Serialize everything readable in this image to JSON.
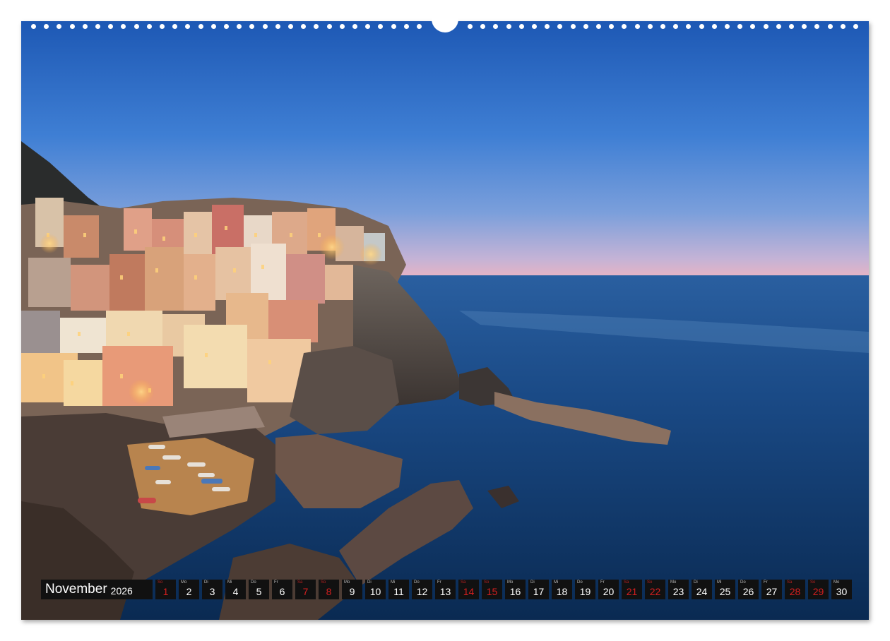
{
  "calendar": {
    "month": "November",
    "year": "2026",
    "days": [
      {
        "n": "1",
        "wd": "So",
        "weekend": true
      },
      {
        "n": "2",
        "wd": "Mo",
        "weekend": false
      },
      {
        "n": "3",
        "wd": "Di",
        "weekend": false
      },
      {
        "n": "4",
        "wd": "Mi",
        "weekend": false
      },
      {
        "n": "5",
        "wd": "Do",
        "weekend": false
      },
      {
        "n": "6",
        "wd": "Fr",
        "weekend": false
      },
      {
        "n": "7",
        "wd": "Sa",
        "weekend": true
      },
      {
        "n": "8",
        "wd": "So",
        "weekend": true
      },
      {
        "n": "9",
        "wd": "Mo",
        "weekend": false
      },
      {
        "n": "10",
        "wd": "Di",
        "weekend": false
      },
      {
        "n": "11",
        "wd": "Mi",
        "weekend": false
      },
      {
        "n": "12",
        "wd": "Do",
        "weekend": false
      },
      {
        "n": "13",
        "wd": "Fr",
        "weekend": false
      },
      {
        "n": "14",
        "wd": "Sa",
        "weekend": true
      },
      {
        "n": "15",
        "wd": "So",
        "weekend": true
      },
      {
        "n": "16",
        "wd": "Mo",
        "weekend": false
      },
      {
        "n": "17",
        "wd": "Di",
        "weekend": false
      },
      {
        "n": "18",
        "wd": "Mi",
        "weekend": false
      },
      {
        "n": "19",
        "wd": "Do",
        "weekend": false
      },
      {
        "n": "20",
        "wd": "Fr",
        "weekend": false
      },
      {
        "n": "21",
        "wd": "Sa",
        "weekend": true
      },
      {
        "n": "22",
        "wd": "So",
        "weekend": true
      },
      {
        "n": "23",
        "wd": "Mo",
        "weekend": false
      },
      {
        "n": "24",
        "wd": "Di",
        "weekend": false
      },
      {
        "n": "25",
        "wd": "Mi",
        "weekend": false
      },
      {
        "n": "26",
        "wd": "Do",
        "weekend": false
      },
      {
        "n": "27",
        "wd": "Fr",
        "weekend": false
      },
      {
        "n": "28",
        "wd": "Sa",
        "weekend": true
      },
      {
        "n": "29",
        "wd": "So",
        "weekend": true
      },
      {
        "n": "30",
        "wd": "Mo",
        "weekend": false
      }
    ]
  },
  "colors": {
    "sky_top": "#1f5fb8",
    "sky_horizon": "#e9b6c6",
    "sea": "#0f3c6e",
    "bar": "#111111",
    "weekend": "#d41f1f"
  }
}
